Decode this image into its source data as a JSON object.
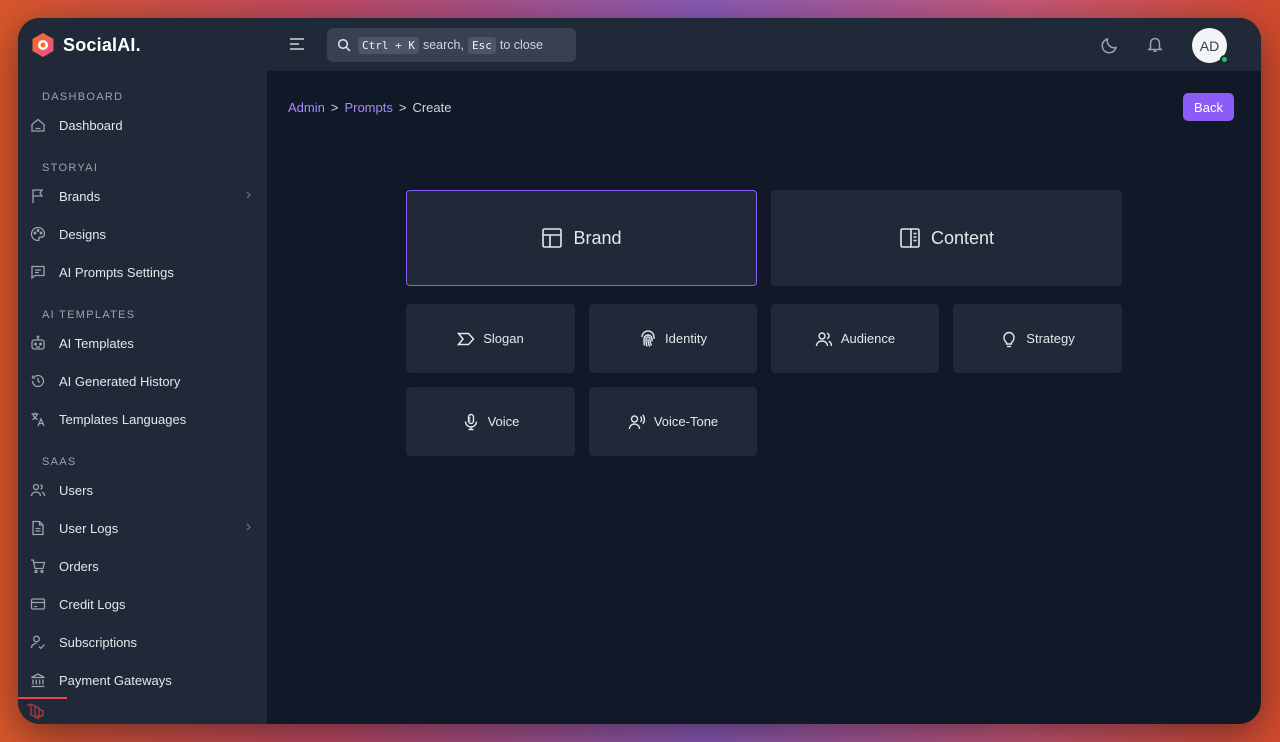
{
  "app": {
    "name": "SocialAI."
  },
  "sidebar": {
    "sections": [
      {
        "title": "DASHBOARD",
        "items": [
          {
            "label": "Dashboard",
            "icon": "home-icon"
          }
        ]
      },
      {
        "title": "STORYAI",
        "items": [
          {
            "label": "Brands",
            "icon": "flag-icon",
            "has_submenu": true
          },
          {
            "label": "Designs",
            "icon": "palette-icon"
          },
          {
            "label": "AI Prompts Settings",
            "icon": "message-icon"
          }
        ]
      },
      {
        "title": "AI TEMPLATES",
        "items": [
          {
            "label": "AI Templates",
            "icon": "robot-icon"
          },
          {
            "label": "AI Generated History",
            "icon": "history-icon"
          },
          {
            "label": "Templates Languages",
            "icon": "translate-icon"
          }
        ]
      },
      {
        "title": "SAAS",
        "items": [
          {
            "label": "Users",
            "icon": "users-icon"
          },
          {
            "label": "User Logs",
            "icon": "file-icon",
            "has_submenu": true
          },
          {
            "label": "Orders",
            "icon": "cart-icon"
          },
          {
            "label": "Credit Logs",
            "icon": "credit-card-icon"
          },
          {
            "label": "Subscriptions",
            "icon": "user-check-icon"
          },
          {
            "label": "Payment Gateways",
            "icon": "bank-icon"
          }
        ]
      }
    ]
  },
  "topbar": {
    "search": {
      "key1": "Ctrl + K",
      "text1": "search,",
      "key2": "Esc",
      "text2": "to close"
    },
    "avatar_initials": "AD"
  },
  "breadcrumb": {
    "admin": "Admin",
    "sep": ">",
    "prompts": "Prompts",
    "create": "Create"
  },
  "actions": {
    "back_label": "Back"
  },
  "main_cards": [
    {
      "label": "Brand",
      "icon": "layout-icon",
      "selected": true
    },
    {
      "label": "Content",
      "icon": "book-open-icon",
      "selected": false
    }
  ],
  "sub_cards": [
    {
      "label": "Slogan",
      "icon": "tag-arrow-icon"
    },
    {
      "label": "Identity",
      "icon": "fingerprint-icon"
    },
    {
      "label": "Audience",
      "icon": "users-icon"
    },
    {
      "label": "Strategy",
      "icon": "lightbulb-icon"
    },
    {
      "label": "Voice",
      "icon": "microphone-icon"
    },
    {
      "label": "Voice-Tone",
      "icon": "speaking-user-icon"
    }
  ],
  "colors": {
    "accent": "#8b5cf6",
    "link": "#a78bfa",
    "sidebar_bg": "#1f2937",
    "main_bg": "#111827",
    "online": "#22c55e"
  }
}
